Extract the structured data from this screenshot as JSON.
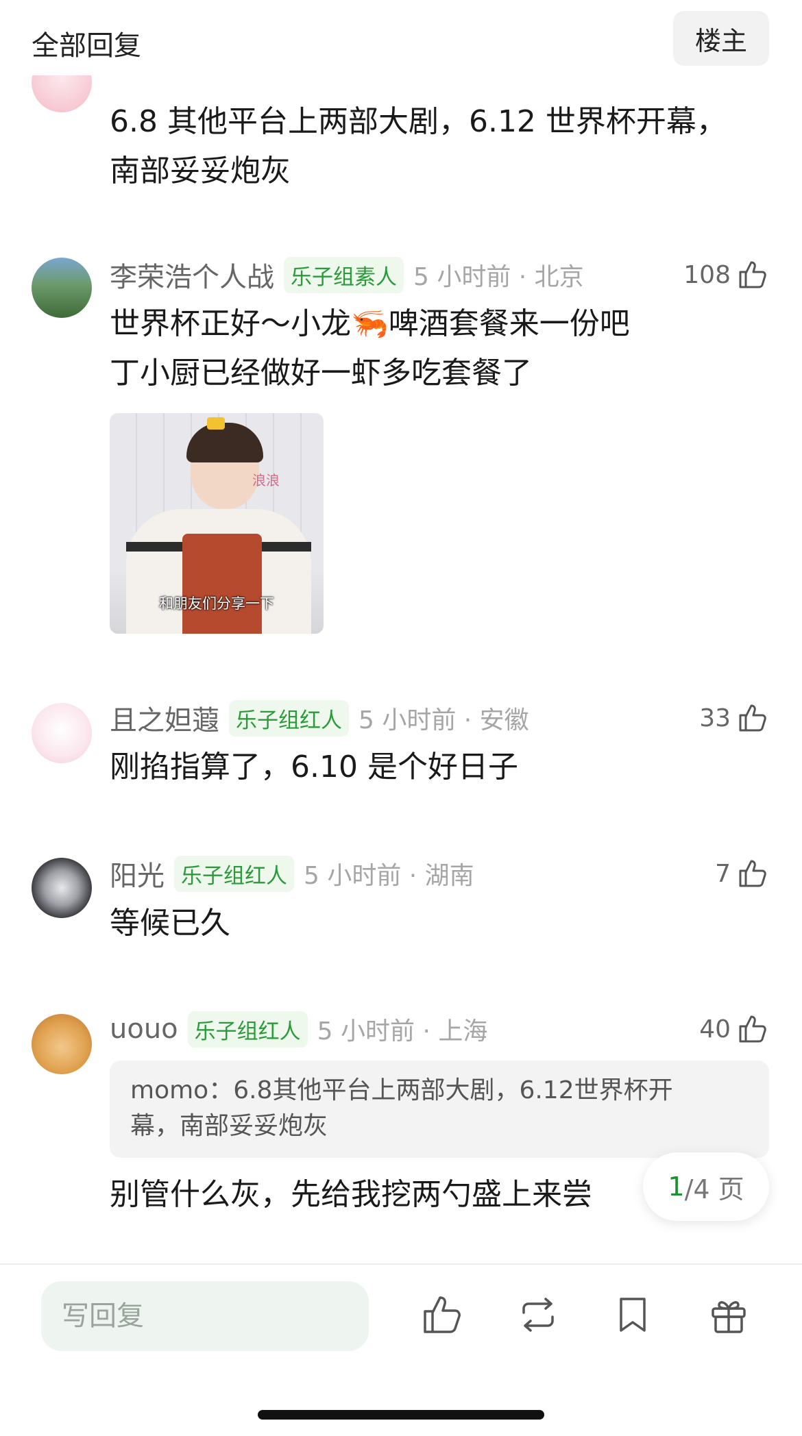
{
  "header": {
    "title": "全部回复",
    "owner_button": "楼主"
  },
  "comments": [
    {
      "text_lines": [
        "6.8 其他平台上两部大剧，6.12 世界杯开幕，",
        "南部妥妥炮灰"
      ]
    },
    {
      "username": "李荣浩个人战",
      "badge": "乐子组素人",
      "time": "5 小时前 · 北京",
      "likes": "108",
      "text_lines": [
        "世界杯正好～小龙🦐啤酒套餐来一份吧",
        "丁小厨已经做好一虾多吃套餐了"
      ],
      "image_caption": "和朋友们分享一下",
      "image_logo_text": "浪浪"
    },
    {
      "username": "且之妲蕸",
      "badge": "乐子组红人",
      "time": "5 小时前 · 安徽",
      "likes": "33",
      "text_lines": [
        "刚掐指算了，6.10 是个好日子"
      ]
    },
    {
      "username": "阳光",
      "badge": "乐子组红人",
      "time": "5 小时前 · 湖南",
      "likes": "7",
      "text_lines": [
        "等候已久"
      ]
    },
    {
      "username": "uouo",
      "badge": "乐子组红人",
      "time": "5 小时前 · 上海",
      "likes": "40",
      "quote_lines": [
        "momo：6.8其他平台上两部大剧，6.12世界杯开",
        "幕，南部妥妥炮灰"
      ],
      "text_lines": [
        "别管什么灰，先给我挖两勺盛上来尝"
      ]
    }
  ],
  "pager": {
    "current": "1",
    "total_text": "/4 页"
  },
  "bottom_bar": {
    "reply_placeholder": "写回复",
    "icons": [
      "like-icon",
      "repost-icon",
      "bookmark-icon",
      "gift-icon"
    ]
  },
  "colors": {
    "badge_green": "#2b9a3b",
    "badge_bg": "#eef8ec",
    "reply_bg": "#eef4ef"
  }
}
